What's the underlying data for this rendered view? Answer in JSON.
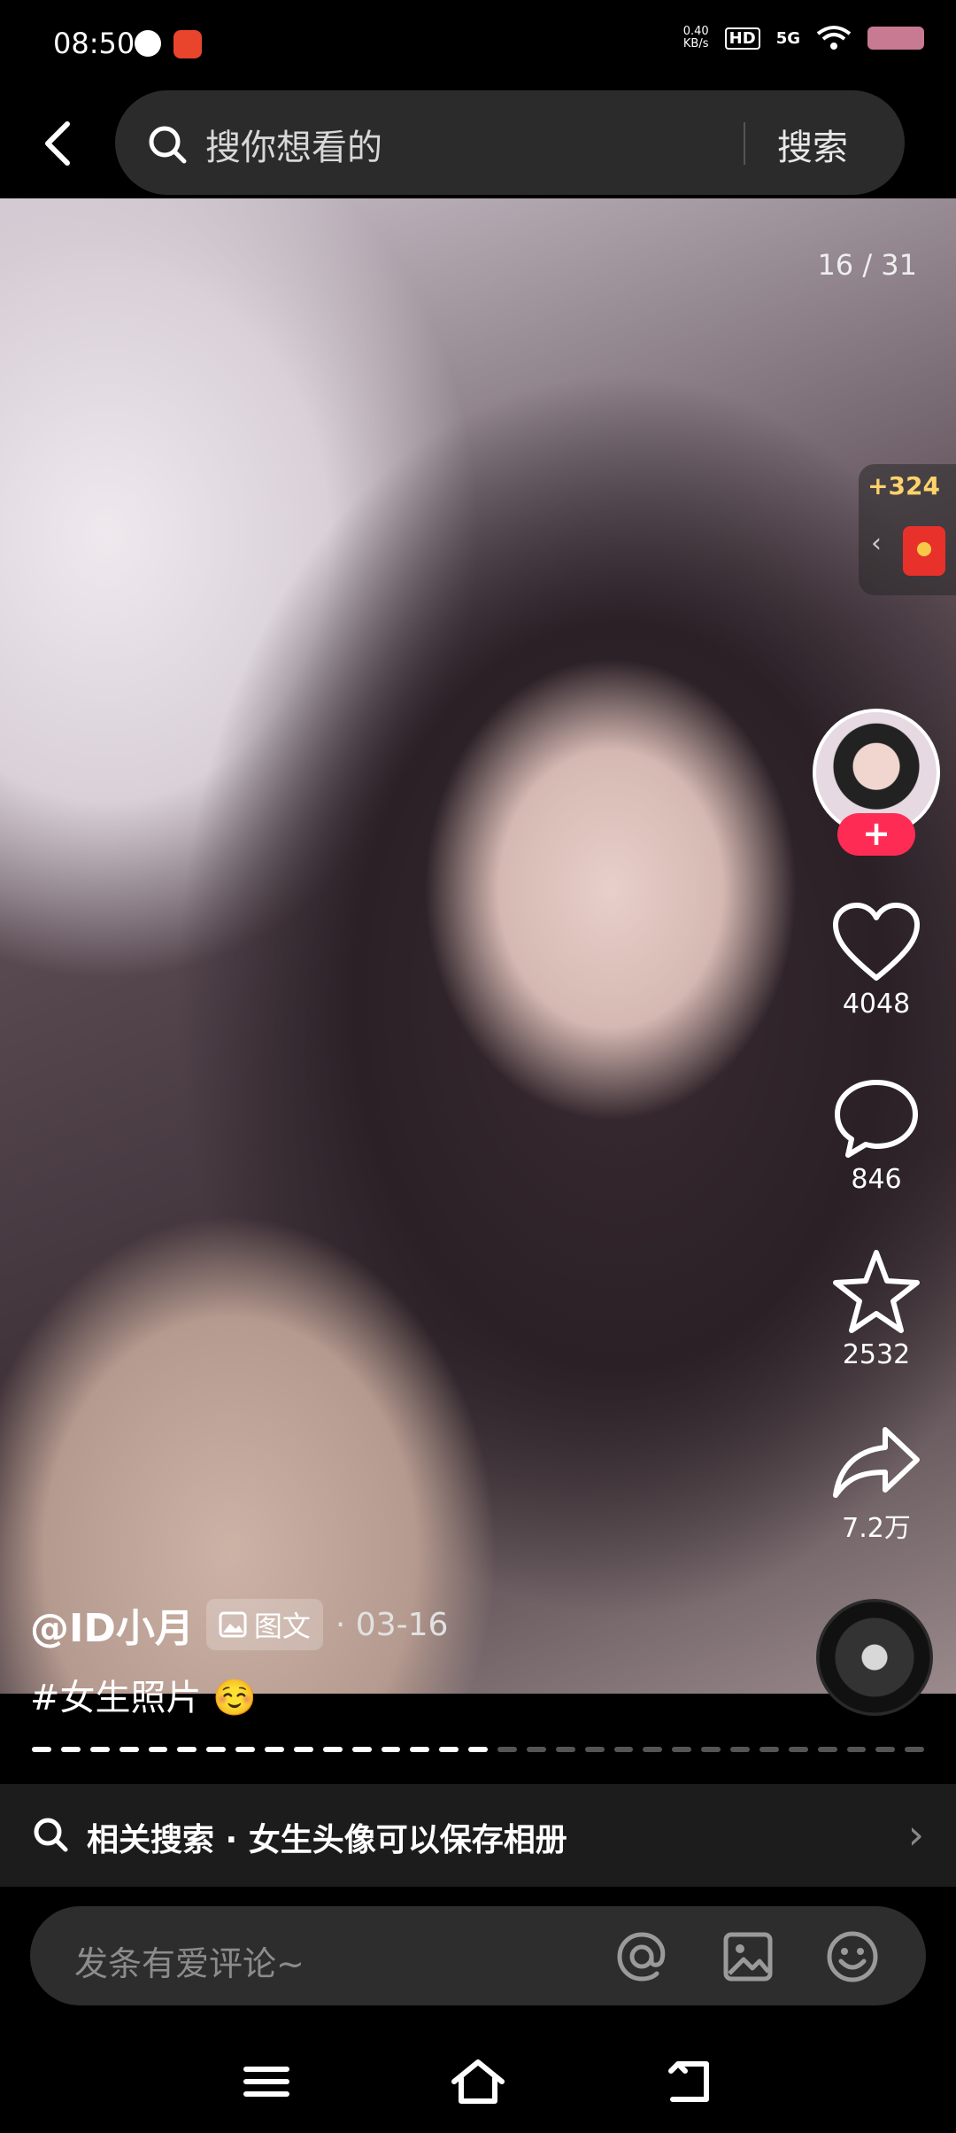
{
  "status_bar": {
    "time": "08:50",
    "net_speed_value": "0.40",
    "net_speed_unit": "KB/s",
    "hd": "HD",
    "signal": "5G"
  },
  "search": {
    "placeholder": "搜你想看的",
    "button": "搜索"
  },
  "post": {
    "page_counter": "16 / 31",
    "bonus": "+324",
    "author": "@ID小月",
    "type_label": "图文",
    "date": "· 03-16",
    "hashtag": "#女生照片 ☺️",
    "current_page": 16,
    "total_pages": 31
  },
  "actions": {
    "follow": "+",
    "likes": "4048",
    "comments": "846",
    "favorites": "2532",
    "shares": "7.2万"
  },
  "related_search": {
    "text": "相关搜索 · 女生头像可以保存相册"
  },
  "comment_input": {
    "placeholder": "发条有爱评论~"
  },
  "colors": {
    "accent": "#fe2c55",
    "bonus": "#ffd36b",
    "battery": "#c77a91"
  },
  "icons": [
    "back-icon",
    "search-icon",
    "heart-icon",
    "comment-icon",
    "star-icon",
    "share-icon",
    "at-icon",
    "image-icon",
    "emoji-icon",
    "menu-icon",
    "home-icon",
    "back-nav-icon"
  ]
}
